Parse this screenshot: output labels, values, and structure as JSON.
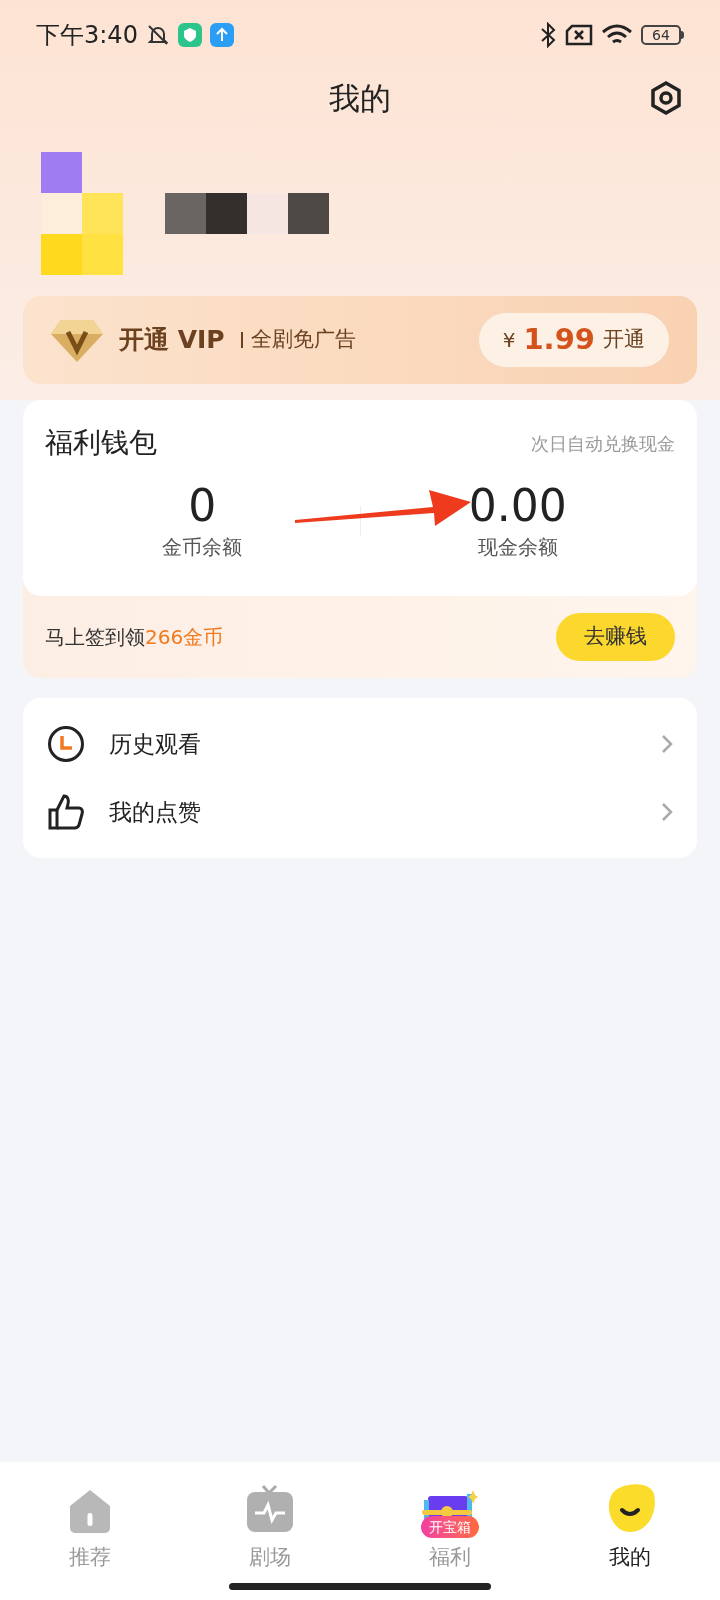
{
  "status_bar": {
    "time": "下午3:40",
    "battery": "64"
  },
  "header": {
    "title": "我的"
  },
  "vip": {
    "title": "开通 VIP",
    "subtitle": "全剧免广告",
    "currency": "¥",
    "price": "1.99",
    "action": "开通"
  },
  "wallet": {
    "title": "福利钱包",
    "note": "次日自动兑换现金",
    "balances": [
      {
        "value": "0",
        "label": "金币余额"
      },
      {
        "value": "0.00",
        "label": "现金余额"
      }
    ],
    "checkin": "马上签到领**266**金币",
    "button": "去赚钱"
  },
  "menu": [
    {
      "kind": "history",
      "label": "历史观看"
    },
    {
      "kind": "like",
      "label": "我的点赞"
    }
  ],
  "tabs": [
    {
      "kind": "home",
      "label": "推荐",
      "selected": false
    },
    {
      "kind": "tv",
      "label": "剧场",
      "selected": false
    },
    {
      "kind": "chest",
      "label": "福利",
      "badge": "开宝箱",
      "selected": false
    },
    {
      "kind": "me",
      "label": "我的",
      "selected": true
    }
  ]
}
